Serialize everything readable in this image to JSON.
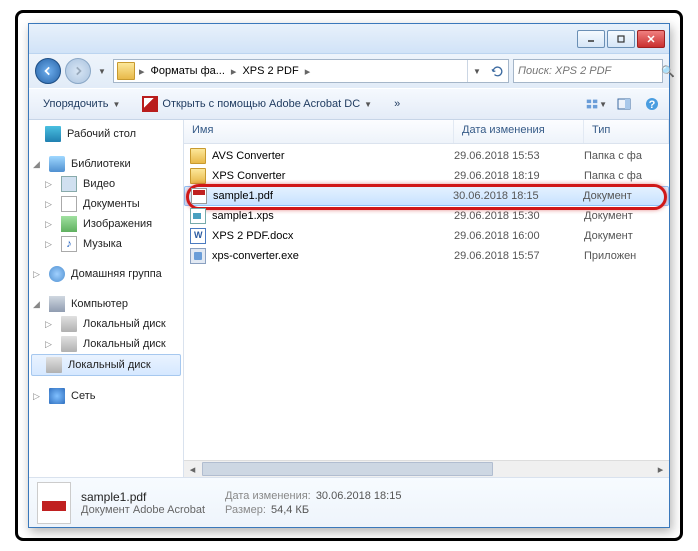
{
  "titlebar": {},
  "nav": {
    "crumb1": "Форматы фа...",
    "crumb2": "XPS 2 PDF",
    "search_placeholder": "Поиск: XPS 2 PDF"
  },
  "toolbar": {
    "organize": "Упорядочить",
    "open_with": "Открыть с помощью Adobe Acrobat DC"
  },
  "sidebar": {
    "desktop": "Рабочий стол",
    "libraries": "Библиотеки",
    "video": "Видео",
    "documents": "Документы",
    "images": "Изображения",
    "music": "Музыка",
    "homegroup": "Домашняя группа",
    "computer": "Компьютер",
    "localdisk": "Локальный диск",
    "network": "Сеть"
  },
  "columns": {
    "name": "Имя",
    "date": "Дата изменения",
    "type": "Тип"
  },
  "files": [
    {
      "name": "AVS Converter",
      "date": "29.06.2018 15:53",
      "type": "Папка с фа",
      "icon": "folder"
    },
    {
      "name": "XPS Converter",
      "date": "29.06.2018 18:19",
      "type": "Папка с фа",
      "icon": "folder"
    },
    {
      "name": "sample1.pdf",
      "date": "30.06.2018 18:15",
      "type": "Документ",
      "icon": "pdf",
      "selected": true
    },
    {
      "name": "sample1.xps",
      "date": "29.06.2018 15:30",
      "type": "Документ",
      "icon": "xps"
    },
    {
      "name": "XPS 2 PDF.docx",
      "date": "29.06.2018 16:00",
      "type": "Документ",
      "icon": "docx"
    },
    {
      "name": "xps-converter.exe",
      "date": "29.06.2018 15:57",
      "type": "Приложен",
      "icon": "exe"
    }
  ],
  "details": {
    "filename": "sample1.pdf",
    "filetype": "Документ Adobe Acrobat",
    "date_label": "Дата изменения:",
    "date_value": "30.06.2018 18:15",
    "size_label": "Размер:",
    "size_value": "54,4 КБ"
  }
}
